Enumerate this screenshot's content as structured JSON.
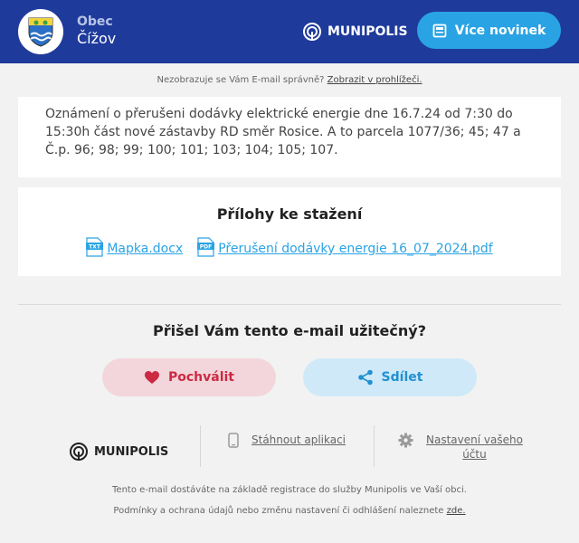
{
  "header": {
    "municipality_type": "Obec",
    "municipality_name": "Čížov",
    "brand": "MUNIPOLIS",
    "more_news_label": "Více novinek",
    "colors": {
      "bar": "#1e3a9b",
      "button": "#2aa3e4"
    }
  },
  "notice": {
    "text": "Nezobrazuje se Vám E-mail správně?",
    "link": "Zobrazit v prohlížeči."
  },
  "message": {
    "line1": "Oznámení o přerušeni dodávky elektrické energie dne 16.7.24 od 7:30 do",
    "line2": "15:30h část nové zástavby RD směr Rosice. A to parcela 1077/36; 45; 47 a",
    "line3": "Č.p. 96; 98; 99; 100; 101; 103; 104; 105; 107."
  },
  "attachments": {
    "title": "Přílohy ke stažení",
    "files": [
      {
        "icon": "txt-file-icon",
        "badge": "TXT",
        "name": "Mapka.docx"
      },
      {
        "icon": "pdf-file-icon",
        "badge": "PDF",
        "name": "Přerušení dodávky energie 16_07_2024.pdf"
      }
    ]
  },
  "feedback": {
    "question": "Přišel Vám tento e-mail užitečný?",
    "like_label": "Pochválit",
    "share_label": "Sdílet",
    "colors": {
      "like": "#cc2a43",
      "share": "#2090d1"
    }
  },
  "footer": {
    "brand": "MUNIPOLIS",
    "download_app": "Stáhnout aplikaci",
    "settings_line1": "Nastavení vašeho",
    "settings_line2": "účtu",
    "info": "Tento e-mail dostáváte na základě registrace do služby Munipolis ve Vaší obci.",
    "terms": "Podmínky a ochrana údajů nebo změnu nastavení či odhlášení naleznete",
    "terms_link": "zde."
  }
}
